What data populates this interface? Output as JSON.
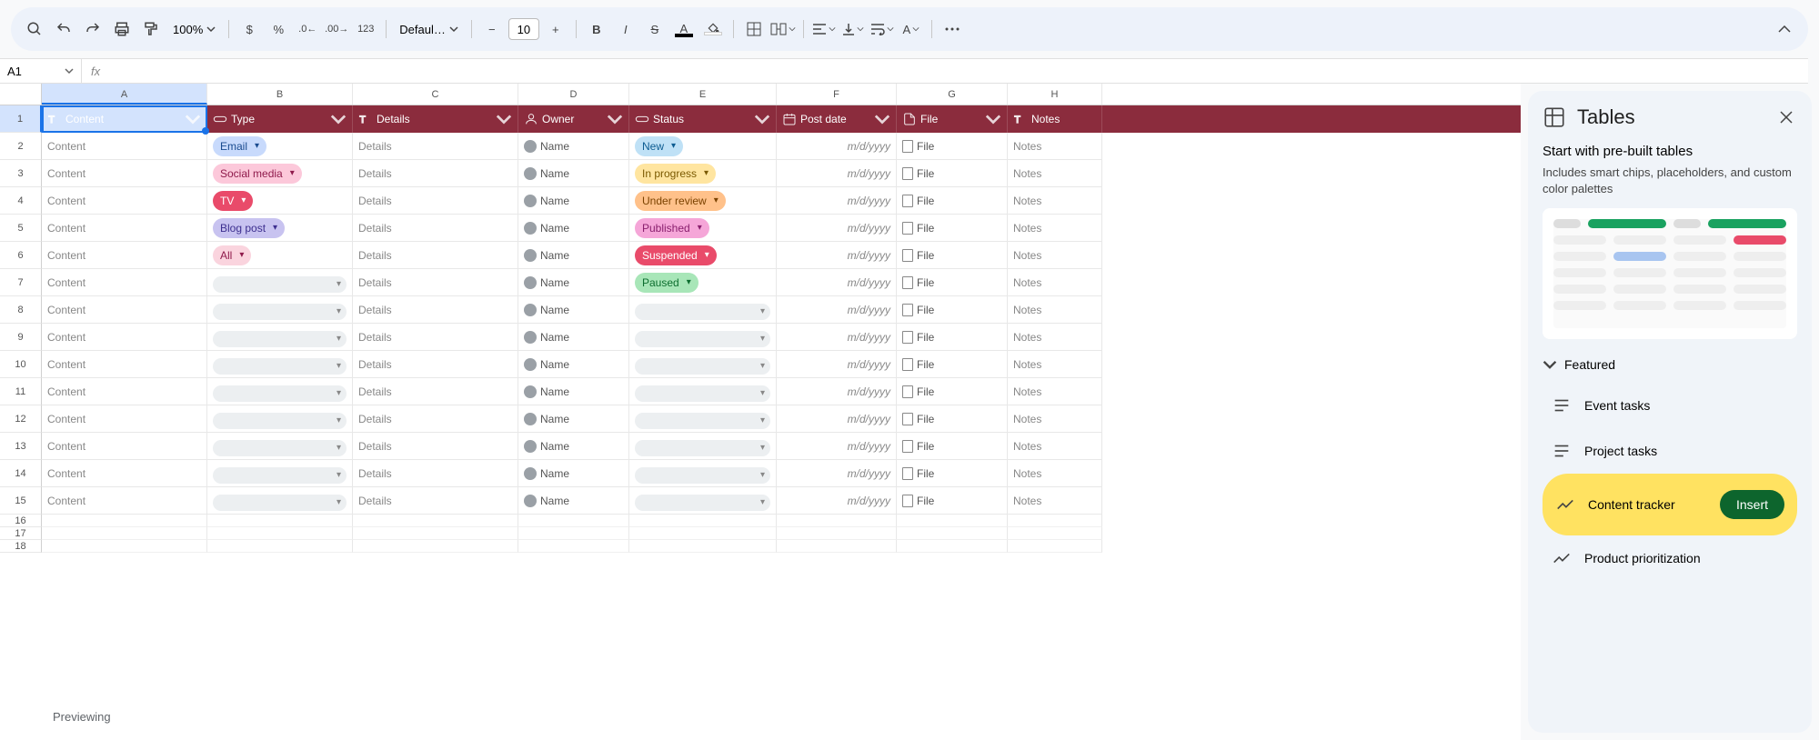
{
  "toolbar": {
    "zoom": "100%",
    "font": "Defaul…",
    "font_size": "10",
    "number_format_123": "123"
  },
  "name_box": "A1",
  "side_panel": {
    "title": "Tables",
    "subtitle": "Start with pre-built tables",
    "description": "Includes smart chips, placeholders, and custom color palettes",
    "section": "Featured",
    "templates": {
      "event": "Event tasks",
      "project": "Project tasks",
      "content": "Content tracker",
      "product": "Product prioritization"
    },
    "insert_label": "Insert"
  },
  "table": {
    "headers": {
      "content": "Content",
      "type": "Type",
      "details": "Details",
      "owner": "Owner",
      "status": "Status",
      "post_date": "Post date",
      "file": "File",
      "notes": "Notes"
    },
    "placeholder": {
      "content": "Content",
      "details": "Details",
      "name": "Name",
      "date": "m/d/yyyy",
      "file": "File",
      "notes": "Notes"
    },
    "type_chips": [
      "Email",
      "Social media",
      "TV",
      "Blog post",
      "All",
      "",
      "",
      "",
      "",
      "",
      "",
      "",
      "",
      ""
    ],
    "status_chips": [
      "New",
      "In progress",
      "Under review",
      "Published",
      "Suspended",
      "Paused",
      "",
      "",
      "",
      "",
      "",
      "",
      "",
      ""
    ]
  },
  "preview_label": "Previewing",
  "col_letters": [
    "A",
    "B",
    "C",
    "D",
    "E",
    "F",
    "G",
    "H"
  ]
}
